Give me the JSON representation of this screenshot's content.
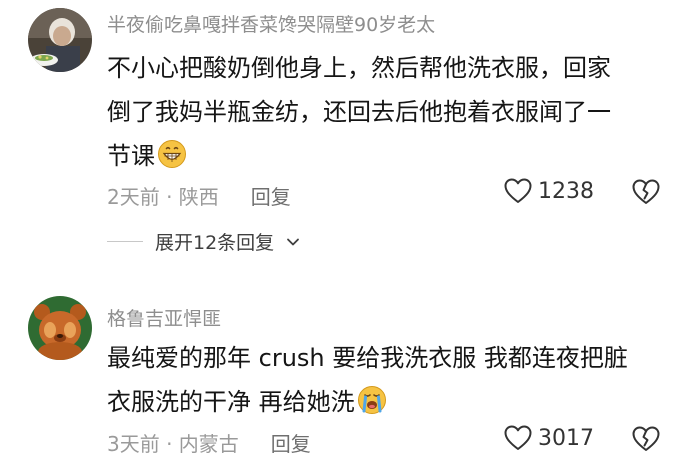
{
  "comments": [
    {
      "username": "半夜偷吃鼻嘎拌香菜馋哭隔壁90岁老太",
      "lines": [
        "不小心把酸奶倒他身上，然后帮他洗衣服，回家",
        "倒了我妈半瓶金纺，还回去后他抱着衣服闻了一",
        "节课"
      ],
      "emoji": "grinning-face-emoji",
      "meta": "2天前 · 陕西",
      "reply_label": "回复",
      "like_count": "1238",
      "expand_label": "展开12条回复"
    },
    {
      "username": "格鲁吉亚悍匪",
      "lines": [
        "最纯爱的那年 crush 要给我洗衣服 我都连夜把脏",
        "衣服洗的干净 再给她洗"
      ],
      "emoji": "loudly-crying-face-emoji",
      "meta": "3天前 · 内蒙古",
      "reply_label": "回复",
      "like_count": "3017"
    }
  ],
  "colors": {
    "username": "#8e8e8e",
    "body_text": "#151515",
    "meta_text": "#9a9a9a",
    "emoji_yellow": "#f6c343"
  },
  "icons": [
    "heart-outline-icon",
    "broken-heart-icon",
    "chevron-down-icon"
  ]
}
